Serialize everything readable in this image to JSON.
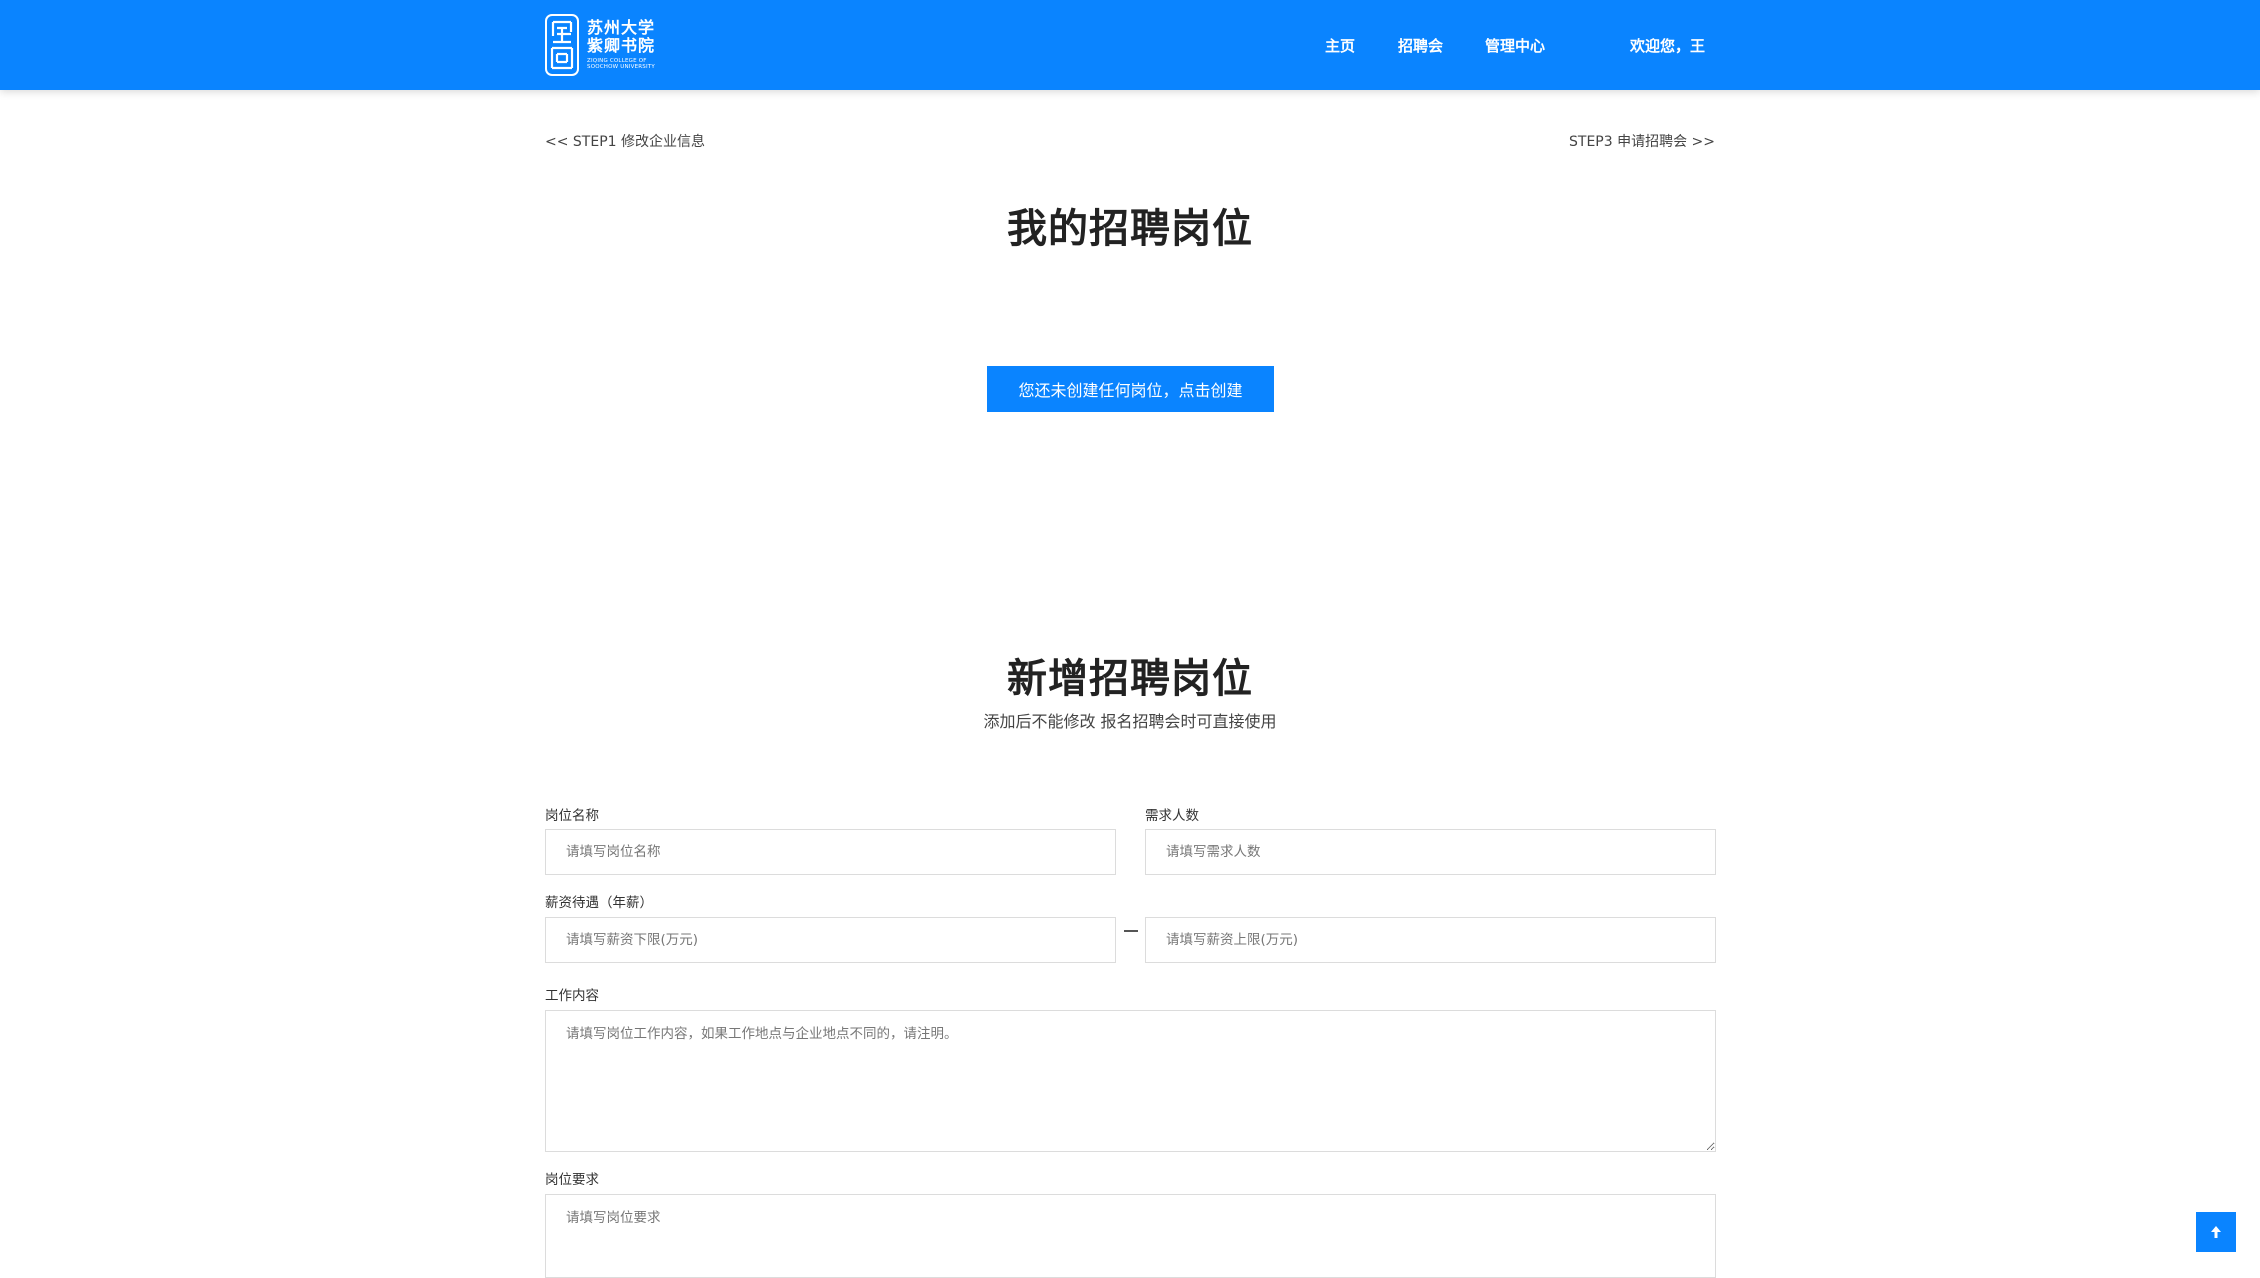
{
  "header": {
    "logo": {
      "line1": "苏州大学",
      "line2": "紫卿书院",
      "english": "ZIQING COLLEGE OF SOOCHOW UNIVERSITY"
    },
    "nav": {
      "home": "主页",
      "fair": "招聘会",
      "admin": "管理中心",
      "welcome": "欢迎您，王"
    },
    "brand_color": "#0a84ff"
  },
  "steps": {
    "prev": "<< STEP1 修改企业信息",
    "next": "STEP3 申请招聘会 >>"
  },
  "my_positions": {
    "title": "我的招聘岗位",
    "create_button": "您还未创建任何岗位，点击创建"
  },
  "new_position": {
    "title": "新增招聘岗位",
    "subtitle": "添加后不能修改 报名招聘会时可直接使用",
    "fields": {
      "name": {
        "label": "岗位名称",
        "placeholder": "请填写岗位名称",
        "value": ""
      },
      "headcount": {
        "label": "需求人数",
        "placeholder": "请填写需求人数",
        "value": ""
      },
      "salary": {
        "label": "薪资待遇（年薪）",
        "min_placeholder": "请填写薪资下限(万元)",
        "max_placeholder": "请填写薪资上限(万元)",
        "separator": "—"
      },
      "content": {
        "label": "工作内容",
        "placeholder": "请填写岗位工作内容，如果工作地点与企业地点不同的，请注明。",
        "value": ""
      },
      "requirements": {
        "label": "岗位要求",
        "placeholder": "请填写岗位要求",
        "value": ""
      }
    }
  },
  "icons": {
    "logo": "college-seal-icon",
    "back_to_top": "arrow-up-icon"
  }
}
